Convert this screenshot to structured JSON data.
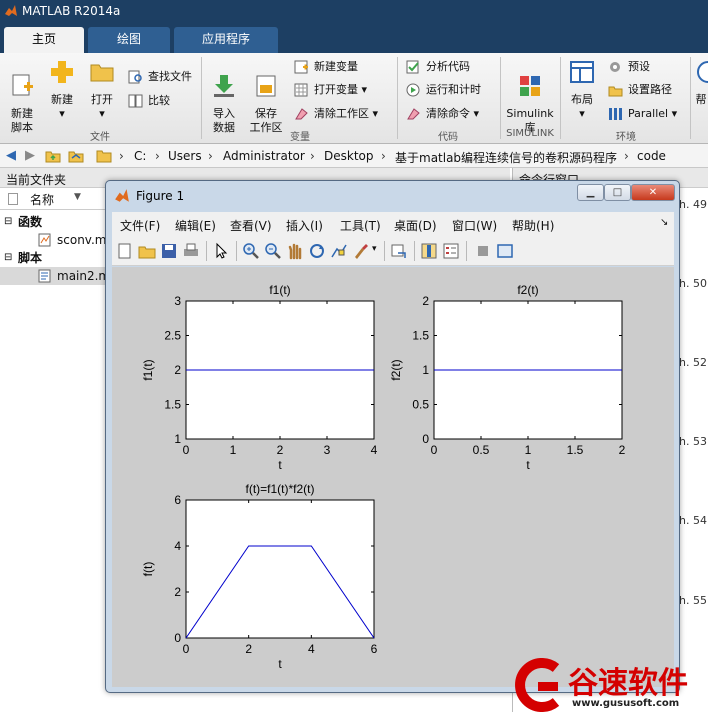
{
  "app": {
    "title": "MATLAB R2014a"
  },
  "tabs": [
    {
      "label": "主页",
      "active": true
    },
    {
      "label": "绘图"
    },
    {
      "label": "应用程序"
    }
  ],
  "ribbon": {
    "new_script": "新建\n脚本",
    "new": "新建",
    "open": "打开",
    "find_files": "查找文件",
    "compare": "比较",
    "import_data": "导入\n数据",
    "save_workspace": "保存\n工作区",
    "new_variable": "新建变量",
    "open_variable": "打开变量",
    "clear_workspace": "清除工作区",
    "analyze_code": "分析代码",
    "run_and_time": "运行和计时",
    "clear_commands": "清除命令",
    "simulink_library": "Simulink\n库",
    "layout": "布局",
    "preferences": "预设",
    "set_path": "设置路径",
    "parallel": "Parallel",
    "help": "帮",
    "sections": {
      "file": "文件",
      "variable": "变量",
      "code": "代码",
      "simulink": "SIMULINK",
      "environment": "环境"
    }
  },
  "address": {
    "crumbs": [
      "C:",
      "Users",
      "Administrator",
      "Desktop",
      "基于matlab编程连续信号的卷积源码程序",
      "code"
    ]
  },
  "current_folder": {
    "title": "当前文件夹",
    "name_col": "名称",
    "sort_arrow": "▼",
    "groups": [
      {
        "label": "函数",
        "items": [
          "sconv.m"
        ]
      },
      {
        "label": "脚本",
        "items": [
          "main2.m"
        ]
      }
    ]
  },
  "command_window": {
    "title": "命令行窗口",
    "line_numbers": [
      "h. 49",
      "h. 50",
      "h. 52",
      "h. 53",
      "h. 54",
      "h. 55"
    ]
  },
  "figure": {
    "title": "Figure 1",
    "menus": [
      "文件(F)",
      "编辑(E)",
      "查看(V)",
      "插入(I)",
      "工具(T)",
      "桌面(D)",
      "窗口(W)",
      "帮助(H)"
    ],
    "menu_overflow": "↘",
    "win_buttons": {
      "minimize": "▁",
      "maximize": "□",
      "close": "✕"
    }
  },
  "chart_data": [
    {
      "type": "line",
      "title": "f1(t)",
      "xlabel": "t",
      "ylabel": "f1(t)",
      "xlim": [
        0,
        4
      ],
      "ylim": [
        1,
        3
      ],
      "xticks": [
        0,
        1,
        2,
        3,
        4
      ],
      "yticks": [
        1,
        1.5,
        2,
        2.5,
        3
      ],
      "series": [
        {
          "x": [
            0,
            4
          ],
          "y": [
            2,
            2
          ],
          "color": "#0000cc"
        }
      ]
    },
    {
      "type": "line",
      "title": "f2(t)",
      "xlabel": "t",
      "ylabel": "f2(t)",
      "xlim": [
        0,
        2
      ],
      "ylim": [
        0,
        2
      ],
      "xticks": [
        0,
        0.5,
        1,
        1.5,
        2
      ],
      "yticks": [
        0,
        0.5,
        1,
        1.5,
        2
      ],
      "series": [
        {
          "x": [
            0,
            2
          ],
          "y": [
            1,
            1
          ],
          "color": "#0000cc"
        }
      ]
    },
    {
      "type": "line",
      "title": "f(t)=f1(t)*f2(t)",
      "xlabel": "t",
      "ylabel": "f(t)",
      "xlim": [
        0,
        6
      ],
      "ylim": [
        0,
        6
      ],
      "xticks": [
        0,
        2,
        4,
        6
      ],
      "yticks": [
        0,
        2,
        4,
        6
      ],
      "series": [
        {
          "x": [
            0,
            2,
            4,
            6
          ],
          "y": [
            0,
            4,
            4,
            0
          ],
          "color": "#0000cc"
        }
      ]
    }
  ],
  "watermark": {
    "brand": "谷速软件",
    "url": "www.gususoft.com"
  },
  "colors": {
    "title_bar": "#1d3f63",
    "plot_line": "#0000cc",
    "canvas_bg": "#cccccc",
    "watermark_red": "#d40000"
  }
}
